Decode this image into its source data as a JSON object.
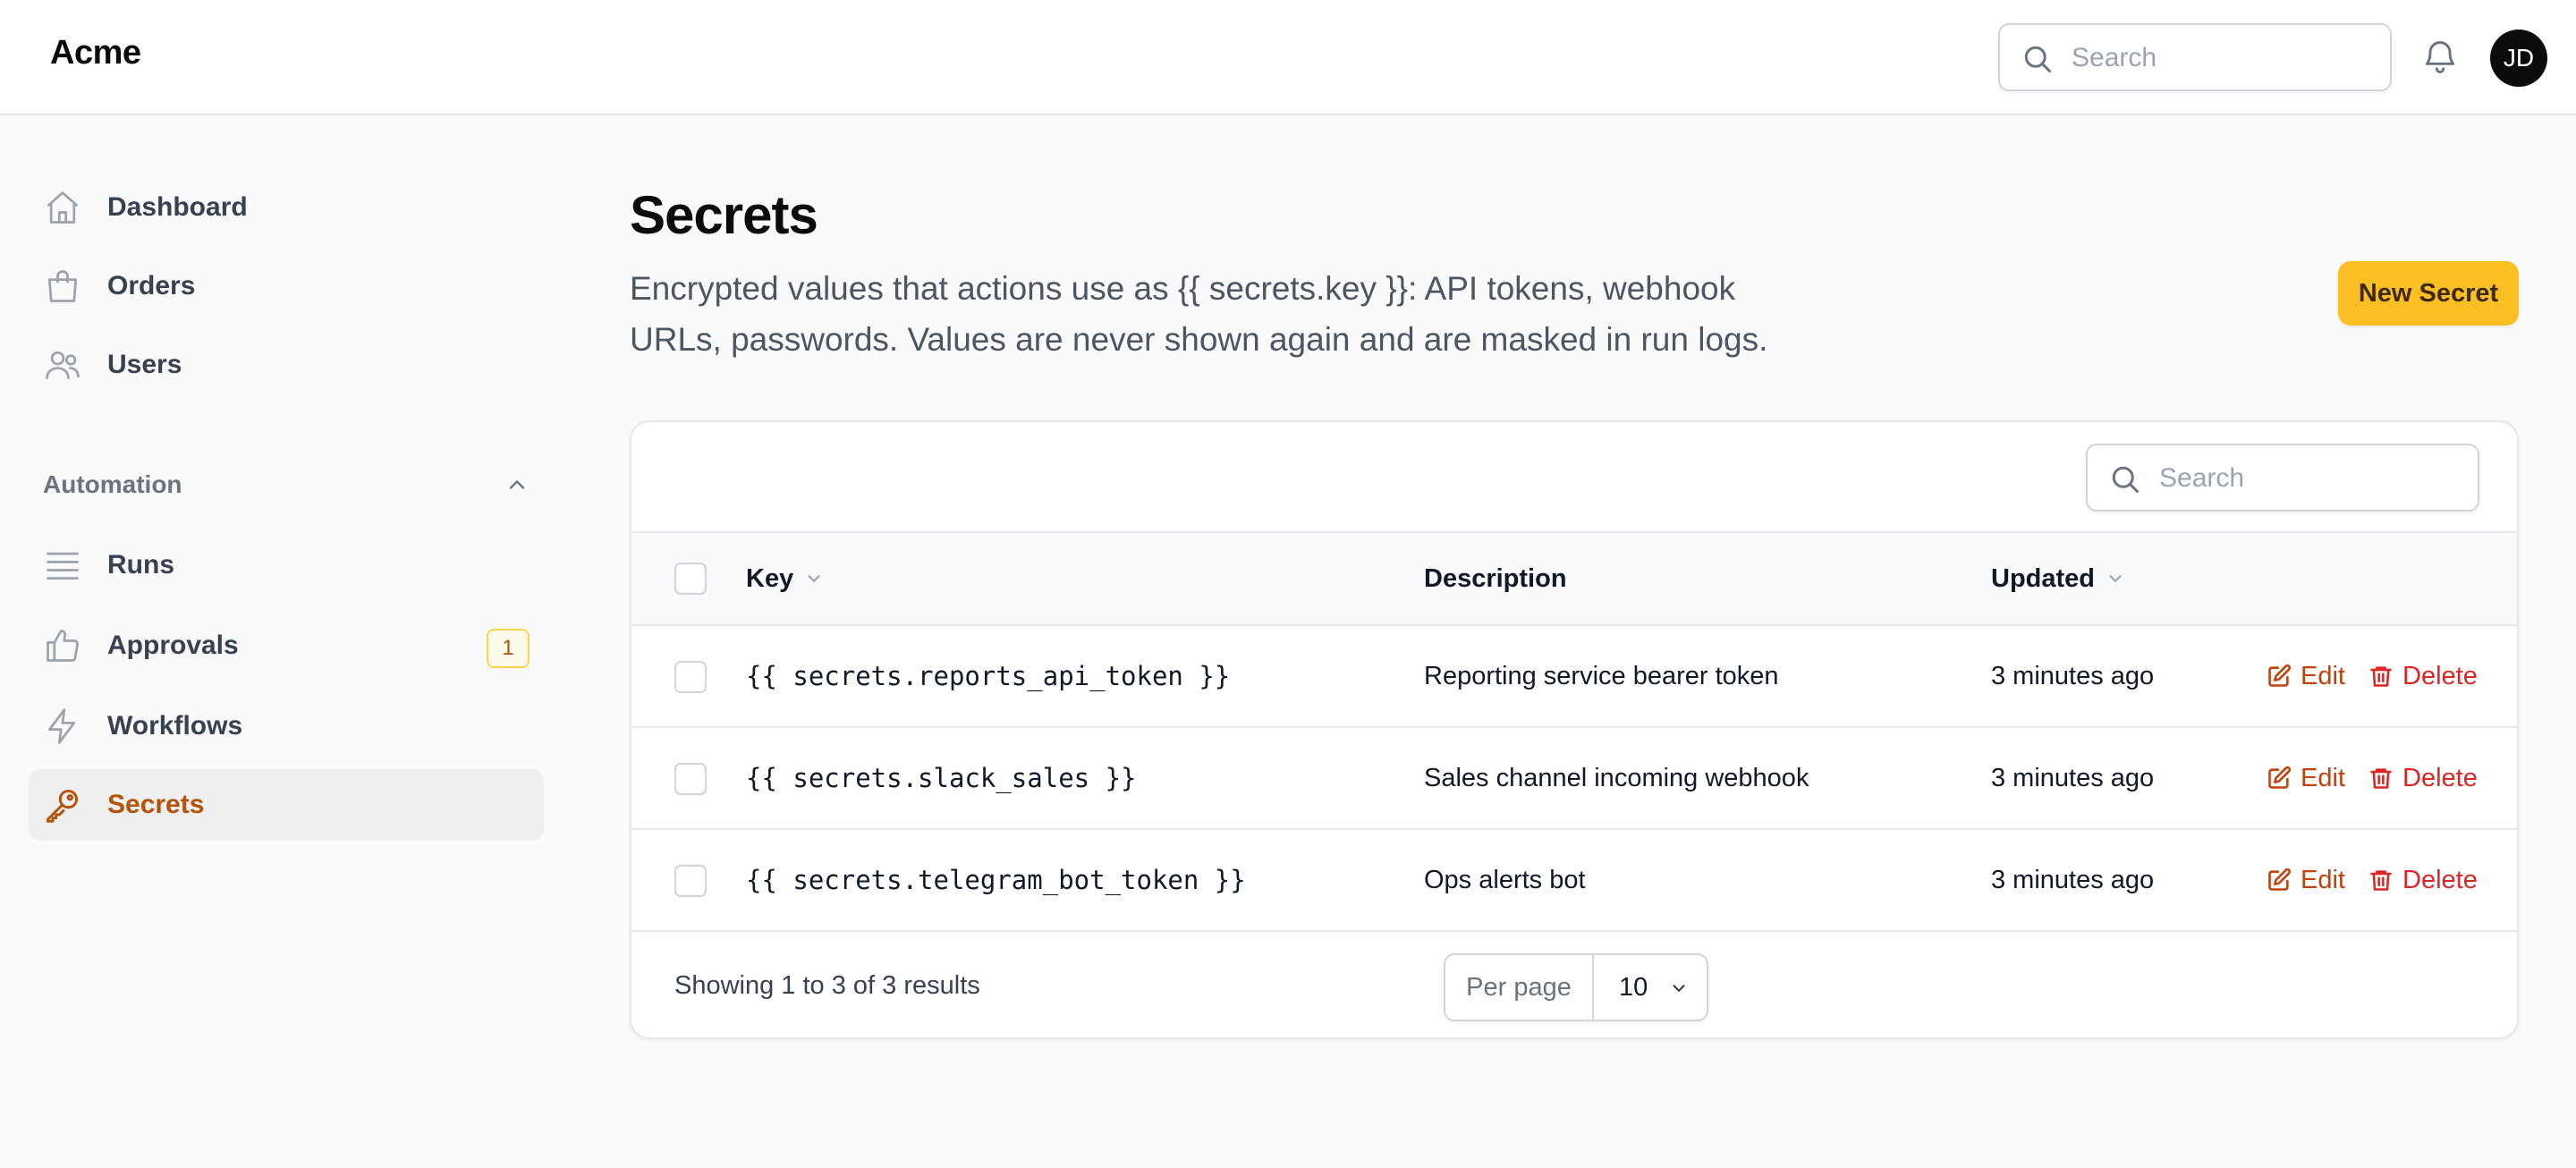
{
  "header": {
    "brand": "Acme",
    "search_placeholder": "Search",
    "avatar_initials": "JD"
  },
  "sidebar": {
    "items": [
      {
        "label": "Dashboard",
        "icon": "home-icon"
      },
      {
        "label": "Orders",
        "icon": "shopping-bag-icon"
      },
      {
        "label": "Users",
        "icon": "users-icon"
      }
    ],
    "group": {
      "label": "Automation",
      "expanded": true,
      "items": [
        {
          "label": "Runs",
          "icon": "list-icon"
        },
        {
          "label": "Approvals",
          "icon": "thumbs-up-icon",
          "badge": "1"
        },
        {
          "label": "Workflows",
          "icon": "bolt-icon"
        },
        {
          "label": "Secrets",
          "icon": "key-icon",
          "active": true
        }
      ]
    }
  },
  "main": {
    "title": "Secrets",
    "description": "Encrypted values that actions use as {{ secrets.key }}: API tokens, webhook URLs, passwords. Values are never shown again and are masked in run logs.",
    "new_button": "New Secret"
  },
  "table": {
    "search_placeholder": "Search",
    "columns": [
      {
        "label": "Key",
        "sortable": true
      },
      {
        "label": "Description",
        "sortable": false
      },
      {
        "label": "Updated",
        "sortable": true
      }
    ],
    "rows": [
      {
        "key": "{{ secrets.reports_api_token }}",
        "description": "Reporting service bearer token",
        "updated": "3 minutes ago"
      },
      {
        "key": "{{ secrets.slack_sales }}",
        "description": "Sales channel incoming webhook",
        "updated": "3 minutes ago"
      },
      {
        "key": "{{ secrets.telegram_bot_token }}",
        "description": "Ops alerts bot",
        "updated": "3 minutes ago"
      }
    ],
    "actions": {
      "edit": "Edit",
      "delete": "Delete"
    },
    "footer": {
      "showing": "Showing 1 to 3 of 3 results",
      "per_page_label": "Per page",
      "per_page_value": "10"
    }
  },
  "colors": {
    "accent": "#fbbf24",
    "active_text": "#b45309",
    "edit": "#c2410c",
    "delete": "#dc2626"
  }
}
